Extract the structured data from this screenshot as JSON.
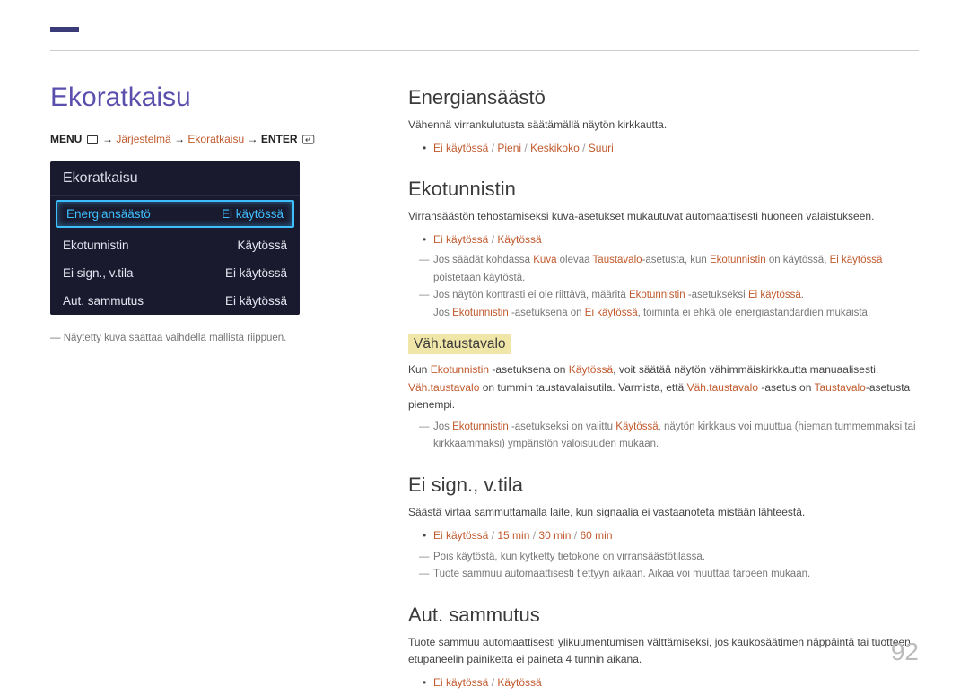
{
  "page_number": "92",
  "left": {
    "title": "Ekoratkaisu",
    "breadcrumb": {
      "menu": "MENU",
      "path1": "Järjestelmä",
      "path2": "Ekoratkaisu",
      "enter": "ENTER"
    },
    "osd": {
      "title": "Ekoratkaisu",
      "rows": [
        {
          "label": "Energiansäästö",
          "value": "Ei käytössä",
          "selected": true
        },
        {
          "label": "Ekotunnistin",
          "value": "Käytössä",
          "selected": false
        },
        {
          "label": "Ei sign., v.tila",
          "value": "Ei käytössä",
          "selected": false
        },
        {
          "label": "Aut. sammutus",
          "value": "Ei käytössä",
          "selected": false
        }
      ]
    },
    "footnote": "Näytetty kuva saattaa vaihdella mallista riippuen."
  },
  "right": {
    "s1": {
      "h": "Energiansäästö",
      "p1": "Vähennä virrankulutusta säätämällä näytön kirkkautta.",
      "opts": {
        "a": "Ei käytössä",
        "b": "Pieni",
        "c": "Keskikoko",
        "d": "Suuri"
      }
    },
    "s2": {
      "h": "Ekotunnistin",
      "p1": "Virransäästön tehostamiseksi kuva-asetukset mukautuvat automaattisesti huoneen valaistukseen.",
      "opts": {
        "a": "Ei käytössä",
        "b": "Käytössä"
      },
      "n1a": "Jos säädät kohdassa ",
      "n1_kuva": "Kuva",
      "n1b": " olevaa ",
      "n1_taustavalo": "Taustavalo",
      "n1c": "-asetusta, kun ",
      "n1_eko": "Ekotunnistin",
      "n1d": " on käytössä, ",
      "n1_ei": "Ei käytössä",
      "n1e": " poistetaan käytöstä.",
      "n2a": "Jos näytön kontrasti ei ole riittävä, määritä ",
      "n2_eko": "Ekotunnistin",
      "n2b": " -asetukseksi ",
      "n2_ei": "Ei käytössä",
      "n2c": ".",
      "n2d": "Jos ",
      "n2_eko2": "Ekotunnistin",
      "n2e": " -asetuksena on ",
      "n2_ei2": "Ei käytössä",
      "n2f": ", toiminta ei ehkä ole energiastandardien mukaista.",
      "sub_h": "Väh.taustavalo",
      "sub_p1a": "Kun ",
      "sub_p1_eko": "Ekotunnistin",
      "sub_p1b": " -asetuksena on ",
      "sub_p1_kay": "Käytössä",
      "sub_p1c": ", voit säätää näytön vähimmäiskirkkautta manuaalisesti. ",
      "sub_p1_vah": "Väh.taustavalo",
      "sub_p1d": " on tummin taustavalaisutila. Varmista, että ",
      "sub_p1_vah2": "Väh.taustavalo",
      "sub_p1e": " -asetus on ",
      "sub_p1_tausta": "Taustavalo",
      "sub_p1f": "-asetusta pienempi.",
      "sub_n1a": "Jos ",
      "sub_n1_eko": "Ekotunnistin",
      "sub_n1b": " -asetukseksi on valittu ",
      "sub_n1_kay": "Käytössä",
      "sub_n1c": ", näytön kirkkaus voi muuttua (hieman tummemmaksi tai kirkkaammaksi) ympäristön valoisuuden mukaan."
    },
    "s3": {
      "h": "Ei sign., v.tila",
      "p1": "Säästä virtaa sammuttamalla laite, kun signaalia ei vastaanoteta mistään lähteestä.",
      "opts": {
        "a": "Ei käytössä",
        "b": "15 min",
        "c": "30 min",
        "d": "60 min"
      },
      "n1": "Pois käytöstä, kun kytketty tietokone on virransäästötilassa.",
      "n2": "Tuote sammuu automaattisesti tiettyyn aikaan. Aikaa voi muuttaa tarpeen mukaan."
    },
    "s4": {
      "h": "Aut. sammutus",
      "p1": "Tuote sammuu automaattisesti ylikuumentumisen välttämiseksi, jos kaukosäätimen näppäintä tai tuotteen etupaneelin painiketta ei paineta 4 tunnin aikana.",
      "opts": {
        "a": "Ei käytössä",
        "b": "Käytössä"
      }
    }
  },
  "sep": " / ",
  "arrow": " → "
}
